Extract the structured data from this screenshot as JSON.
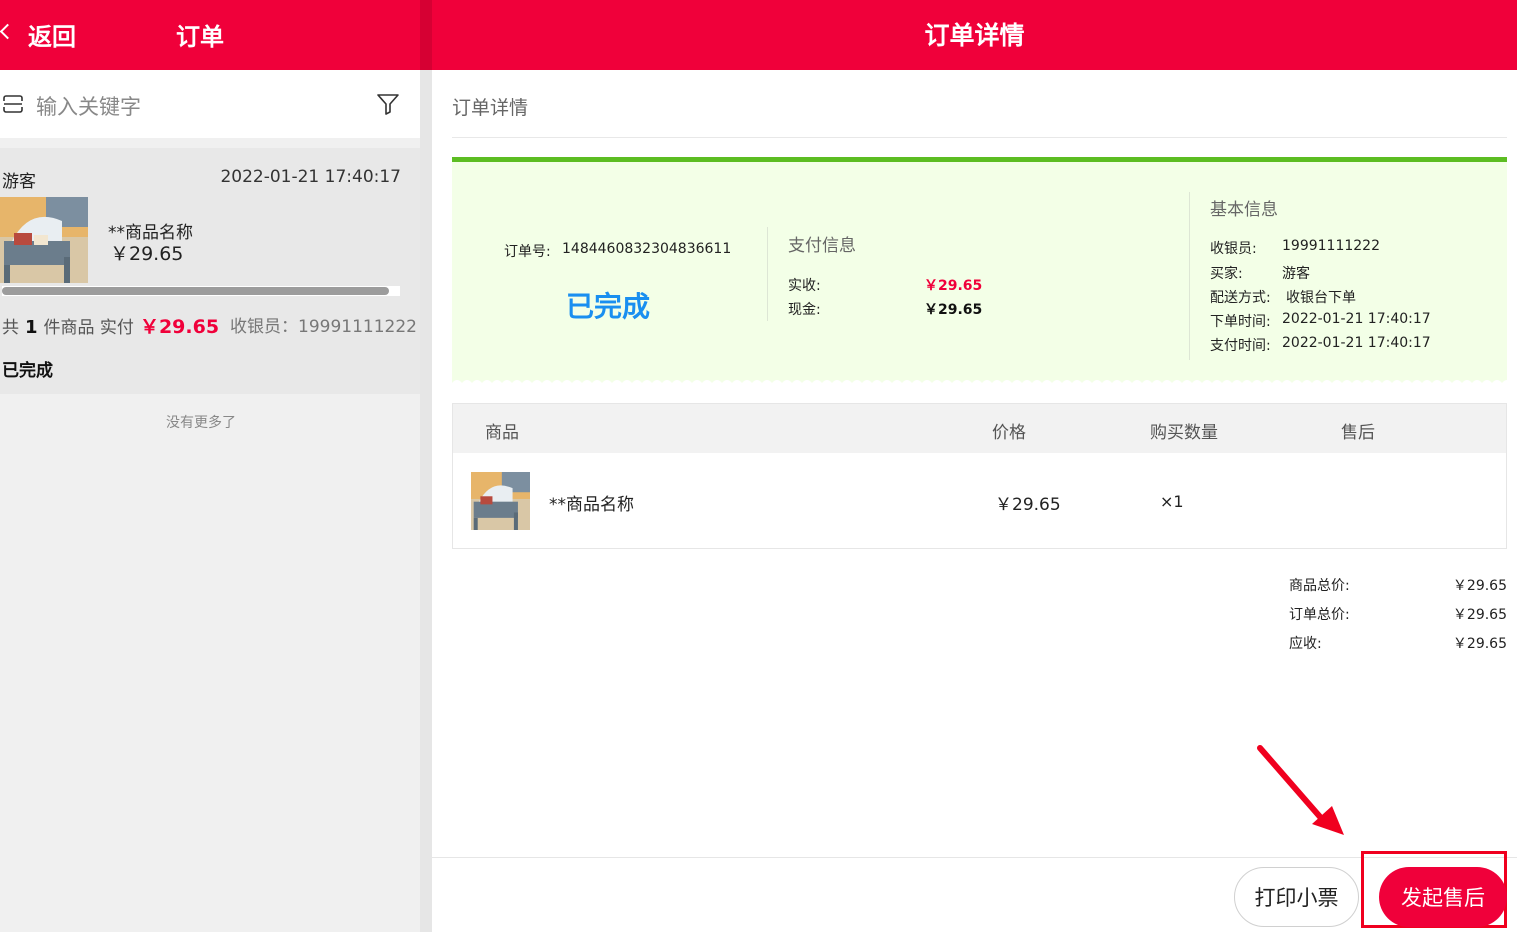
{
  "left_header": {
    "back_label": "返回",
    "title": "订单"
  },
  "right_header": {
    "title": "订单详情"
  },
  "search": {
    "placeholder": "输入关键字"
  },
  "order_card": {
    "buyer": "游客",
    "time": "2022-01-21 17:40:17",
    "product_name": "**商品名称",
    "product_price": "￥29.65",
    "summary_prefix": "共",
    "item_count": "1",
    "summary_mid": "件商品 实付",
    "paid_amount": "￥29.65",
    "cashier": "收银员：19991111222",
    "status": "已完成"
  },
  "no_more": "没有更多了",
  "detail": {
    "section_title": "订单详情",
    "order_no_label": "订单号:",
    "order_no": "1484460832304836611",
    "status": "已完成",
    "payment": {
      "title": "支付信息",
      "received_label": "实收:",
      "received_value": "￥29.65",
      "cash_label": "现金:",
      "cash_value": "￥29.65"
    },
    "basic": {
      "title": "基本信息",
      "rows": [
        {
          "label": "收银员:",
          "value": "19991111222"
        },
        {
          "label": "买家:",
          "value": "游客"
        },
        {
          "label": "配送方式:",
          "value": "收银台下单"
        },
        {
          "label": "下单时间:",
          "value": "2022-01-21 17:40:17"
        },
        {
          "label": "支付时间:",
          "value": "2022-01-21 17:40:17"
        }
      ]
    },
    "table": {
      "headers": [
        "商品",
        "价格",
        "购买数量",
        "售后"
      ],
      "rows": [
        {
          "name": "**商品名称",
          "price": "￥29.65",
          "qty": "×1",
          "after_sale": ""
        }
      ]
    },
    "totals": [
      {
        "label": "商品总价:",
        "value": "￥29.65"
      },
      {
        "label": "订单总价:",
        "value": "￥29.65"
      },
      {
        "label": "应收:",
        "value": "￥29.65"
      }
    ]
  },
  "actions": {
    "print_label": "打印小票",
    "after_sale_label": "发起售后"
  },
  "colors": {
    "brand_red": "#f0003a",
    "status_blue": "#1a8ff0",
    "success_green": "#5cbd22",
    "status_bg": "#f3ffe7"
  },
  "icons": [
    "chevron-left-icon",
    "scan-icon",
    "filter-icon"
  ]
}
